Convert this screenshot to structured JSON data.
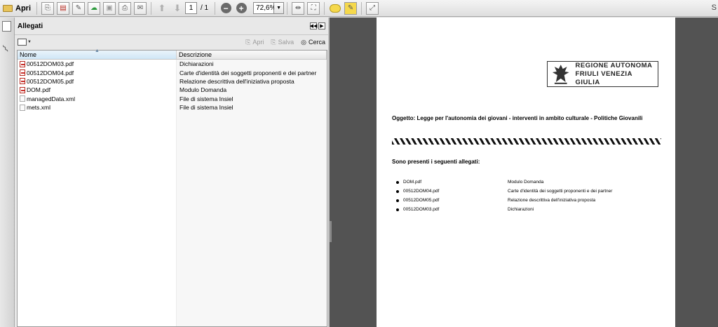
{
  "toolbar": {
    "open_label": "Apri",
    "page_current": "1",
    "page_total": "/ 1",
    "zoom": "72,6%",
    "right_truncated": "S"
  },
  "panel": {
    "title": "Allegati",
    "actions": {
      "open": "Apri",
      "save": "Salva",
      "search": "Cerca"
    },
    "columns": {
      "name": "Nome",
      "description": "Descrizione"
    },
    "rows": [
      {
        "name": "00512DOM03.pdf",
        "description": "Dichiarazioni",
        "type": "pdf"
      },
      {
        "name": "00512DOM04.pdf",
        "description": "Carte d'identità dei soggetti proponenti e dei partner",
        "type": "pdf"
      },
      {
        "name": "00512DOM05.pdf",
        "description": "Relazione descrittiva dell'iniziativa proposta",
        "type": "pdf"
      },
      {
        "name": "DOM.pdf",
        "description": "Modulo Domanda",
        "type": "pdf"
      },
      {
        "name": "managedData.xml",
        "description": "File di sistema Insiel",
        "type": "xml"
      },
      {
        "name": "mets.xml",
        "description": "File di sistema Insiel",
        "type": "xml"
      }
    ]
  },
  "document": {
    "logo_line1": "REGIONE AUTONOMA",
    "logo_line2": "FRIULI VENEZIA GIULIA",
    "subject": "Oggetto: Legge per l'autonomia dei giovani - interventi in ambito culturale - Politiche Giovanili",
    "attachments_heading": "Sono presenti i seguenti allegati:",
    "attachments": [
      {
        "name": "DOM.pdf",
        "description": "Modulo Domanda"
      },
      {
        "name": "00512DOM04.pdf",
        "description": "Carte d'identità dei soggetti proponenti e dei partner"
      },
      {
        "name": "00512DOM05.pdf",
        "description": "Relazione descrittiva dell'iniziativa proposta"
      },
      {
        "name": "00512DOM03.pdf",
        "description": "Dichiarazioni"
      }
    ]
  }
}
